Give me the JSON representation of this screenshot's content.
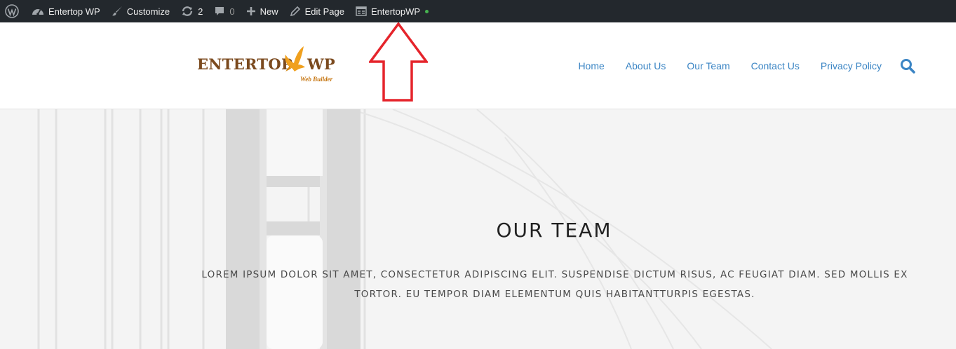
{
  "admin_bar": {
    "items": [
      {
        "icon": "wordpress-icon"
      },
      {
        "icon": "dashboard-icon",
        "label": "Entertop WP"
      },
      {
        "icon": "brush-icon",
        "label": "Customize"
      },
      {
        "icon": "updates-icon",
        "label": "2"
      },
      {
        "icon": "comment-icon",
        "label": "0"
      },
      {
        "icon": "plus-icon",
        "label": "New"
      },
      {
        "icon": "pencil-icon",
        "label": "Edit Page"
      },
      {
        "icon": "builder-icon",
        "label": "EntertopWP",
        "status_color": "#46b450"
      }
    ],
    "background": "#23282d"
  },
  "logo": {
    "text_left": "ENTERTOP",
    "text_right": "WP",
    "tagline": "Web Builder"
  },
  "nav": {
    "items": [
      "Home",
      "About Us",
      "Our Team",
      "Contact Us",
      "Privacy Policy"
    ],
    "link_color": "#3b85c4"
  },
  "hero": {
    "title": "OUR TEAM",
    "text": "LOREM IPSUM DOLOR SIT AMET, CONSECTETUR ADIPISCING ELIT. SUSPENDISE DICTUM RISUS, AC FEUGIAT DIAM. SED MOLLIS EX TORTOR. EU TEMPOR DIAM ELEMENTUM QUIS HABITANTTURPIS EGESTAS."
  },
  "annotation": {
    "color": "#e5242b"
  }
}
